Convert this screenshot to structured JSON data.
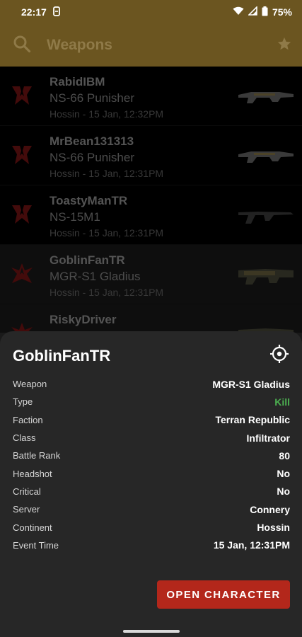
{
  "status_bar": {
    "time": "22:17",
    "battery": "75%"
  },
  "app_bar": {
    "search_placeholder": "Weapons"
  },
  "events": [
    {
      "player": "RabidIBM",
      "weapon": "NS-66 Punisher",
      "meta": "Hossin - 15 Jan, 12:32PM",
      "faction": "TR"
    },
    {
      "player": "MrBean131313",
      "weapon": "NS-66 Punisher",
      "meta": "Hossin - 15 Jan, 12:31PM",
      "faction": "TR"
    },
    {
      "player": "ToastyManTR",
      "weapon": "NS-15M1",
      "meta": "Hossin - 15 Jan, 12:31PM",
      "faction": "TR"
    },
    {
      "player": "GoblinFanTR",
      "weapon": "MGR-S1 Gladius",
      "meta": "Hossin - 15 Jan, 12:31PM",
      "faction": "TR"
    },
    {
      "player": "RiskyDriver",
      "weapon": "",
      "meta": "",
      "faction": "TR"
    }
  ],
  "detail": {
    "title": "GoblinFanTR",
    "fields": [
      {
        "label": "Weapon",
        "value": "MGR-S1 Gladius"
      },
      {
        "label": "Type",
        "value": "Kill"
      },
      {
        "label": "Faction",
        "value": "Terran Republic"
      },
      {
        "label": "Class",
        "value": "Infiltrator"
      },
      {
        "label": "Battle Rank",
        "value": "80"
      },
      {
        "label": "Headshot",
        "value": "No"
      },
      {
        "label": "Critical",
        "value": "No"
      },
      {
        "label": "Server",
        "value": "Connery"
      },
      {
        "label": "Continent",
        "value": "Hossin"
      },
      {
        "label": "Event Time",
        "value": "15 Jan, 12:31PM"
      }
    ],
    "open_button": "OPEN CHARACTER"
  },
  "colors": {
    "app_bar": "#6b5520",
    "accent_button": "#b3271b",
    "kill": "#4caf50",
    "faction_tr": "#8b1a1a"
  }
}
